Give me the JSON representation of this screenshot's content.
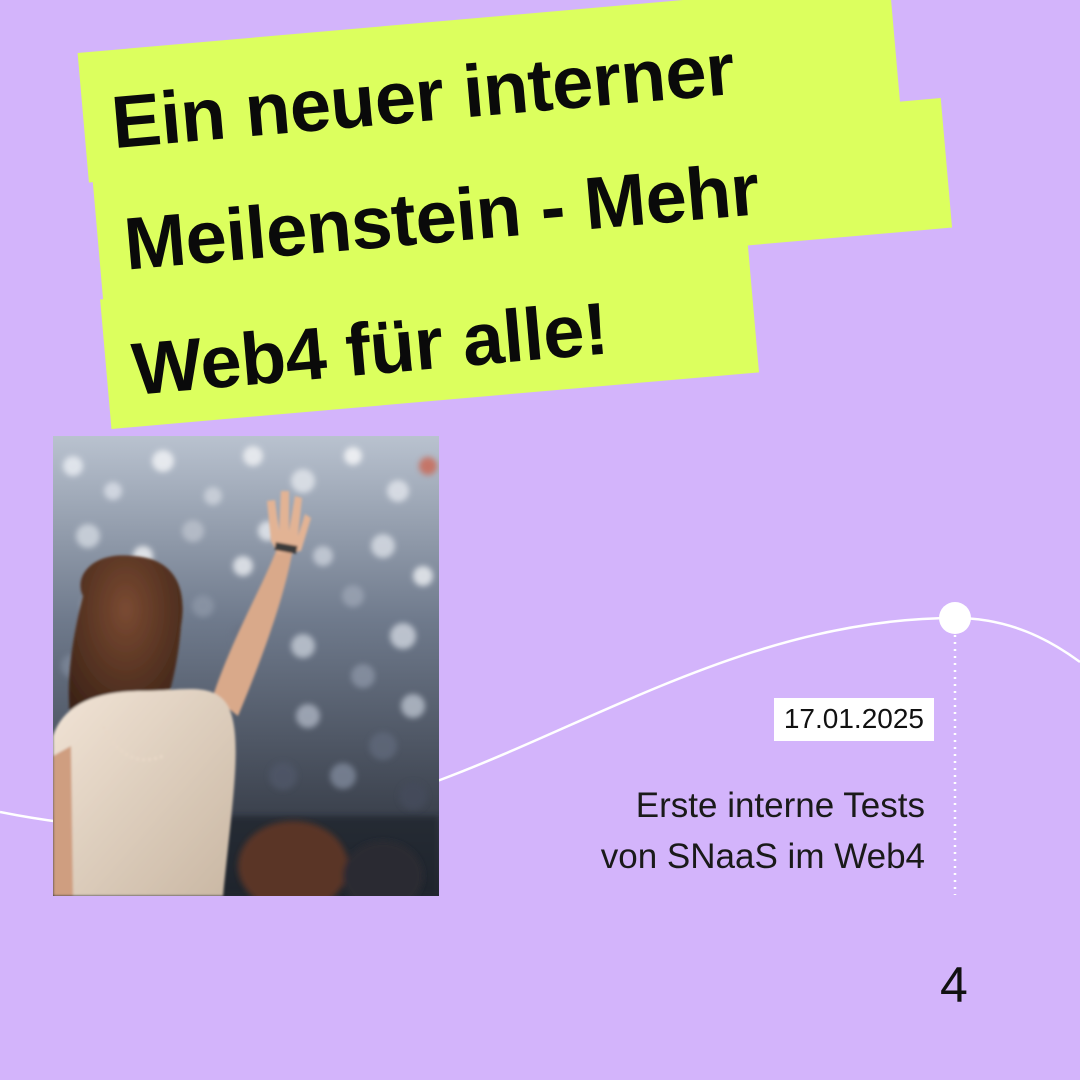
{
  "headline": {
    "line1": "Ein neuer interner",
    "line2": "Meilenstein - Mehr",
    "line3": "Web4 für alle!"
  },
  "event": {
    "date": "17.01.2025",
    "text_line1": "Erste interne Tests",
    "text_line2": "von SNaaS im Web4"
  },
  "page_number": "4",
  "colors": {
    "background": "#d3b4fb",
    "highlight": "#dcff5e",
    "timeline": "#ffffff",
    "text": "#0a0a0a"
  },
  "icons": {
    "timeline_marker": "circle-marker-icon"
  },
  "image": {
    "subject": "concert-crowd-photo"
  }
}
